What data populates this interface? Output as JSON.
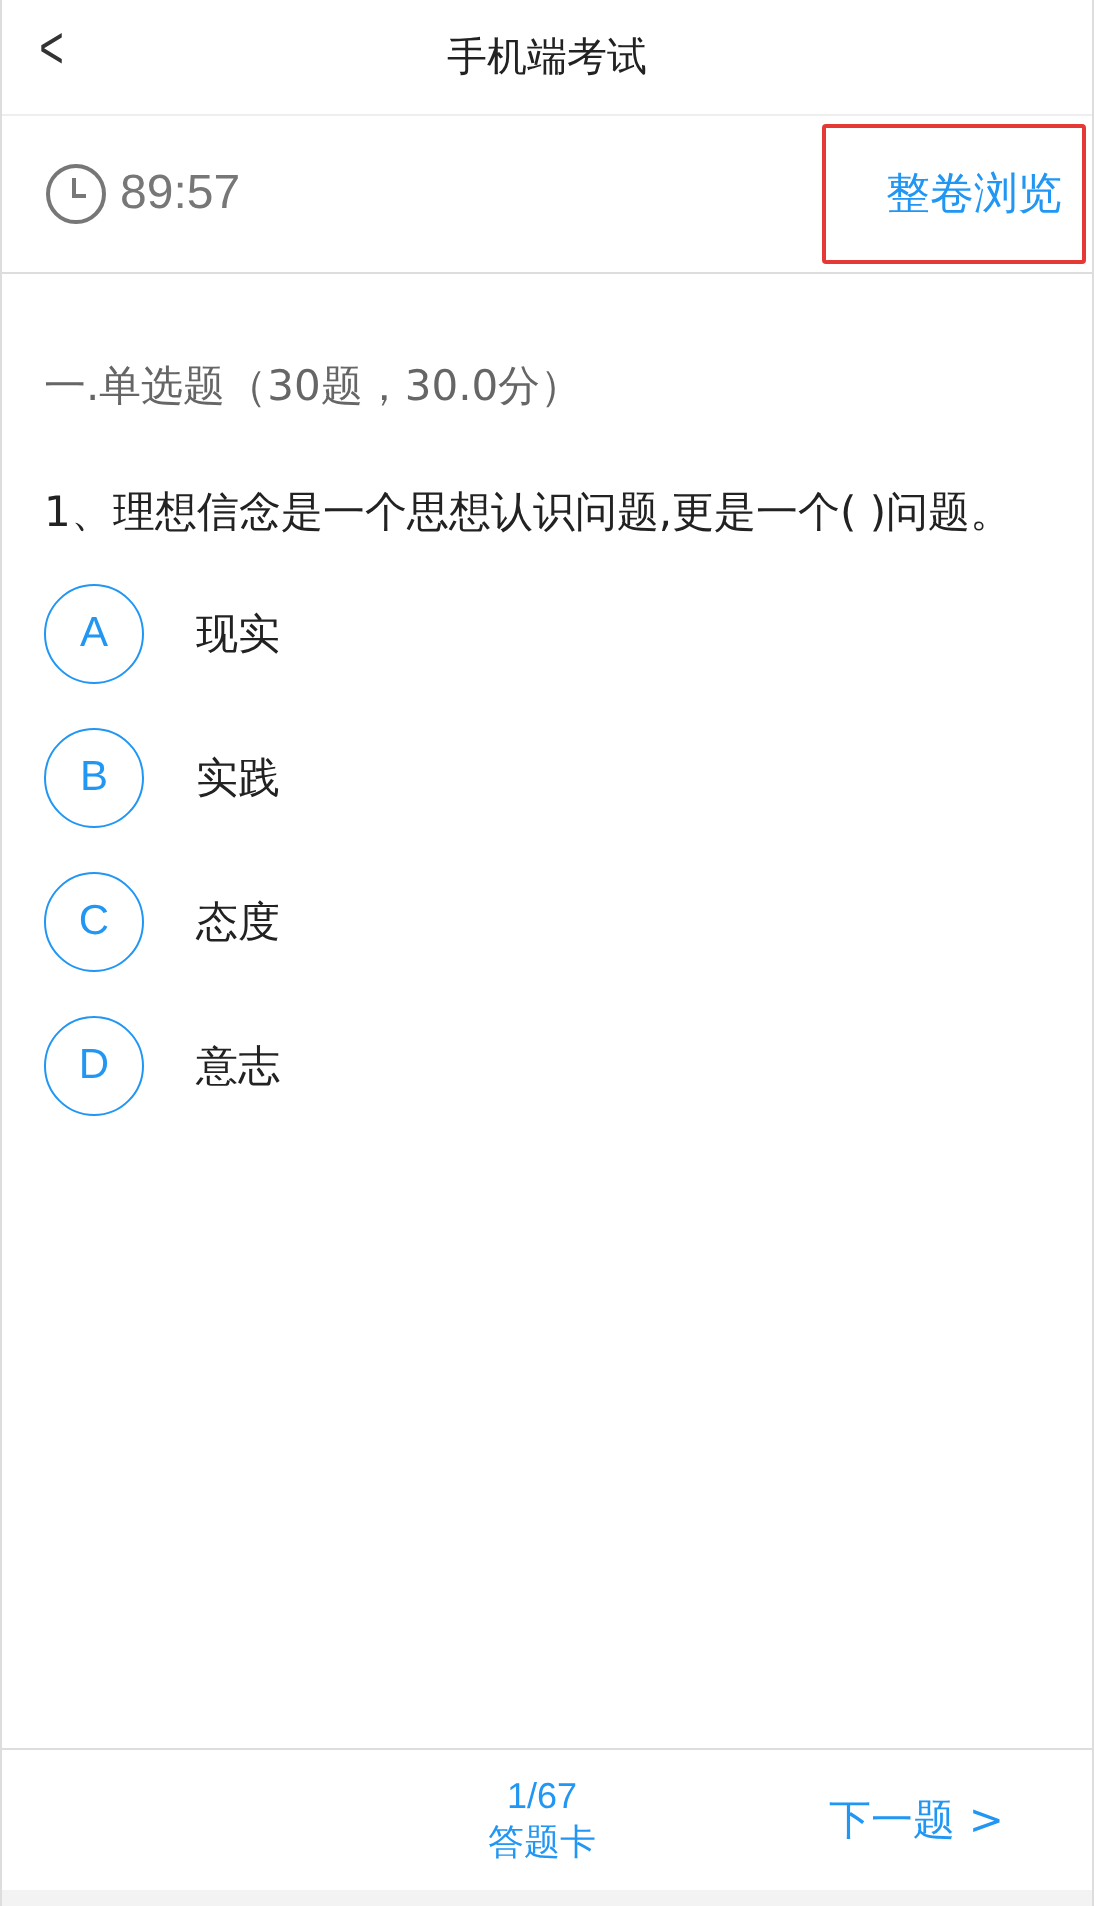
{
  "header": {
    "back": "<",
    "title": "手机端考试"
  },
  "toolbar": {
    "timer": "89:57",
    "browse": {
      "label": "整卷浏览",
      "highlighted": true
    }
  },
  "section_title": "一.单选题（30题，30.0分）",
  "question": "1、理想信念是一个思想认识问题,更是一个( )问题。",
  "options": [
    {
      "letter": "A",
      "text": "现实",
      "selected": false
    },
    {
      "letter": "B",
      "text": "实践",
      "selected": false
    },
    {
      "letter": "C",
      "text": "态度",
      "selected": false
    },
    {
      "letter": "D",
      "text": "意志",
      "selected": false
    }
  ],
  "footer": {
    "progress": "1/67",
    "card": "答题卡",
    "next": "下一题 >"
  }
}
